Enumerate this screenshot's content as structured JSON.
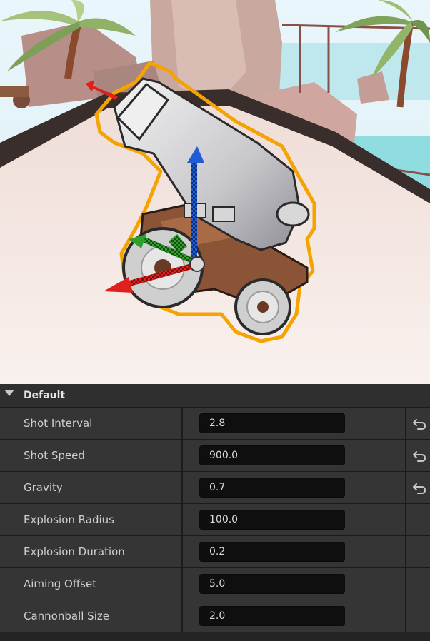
{
  "panel": {
    "category": "Default",
    "rows": [
      {
        "label": "Shot Interval",
        "value": "2.8",
        "resettable": true
      },
      {
        "label": "Shot Speed",
        "value": "900.0",
        "resettable": true
      },
      {
        "label": "Gravity",
        "value": "0.7",
        "resettable": true
      },
      {
        "label": "Explosion Radius",
        "value": "100.0",
        "resettable": false
      },
      {
        "label": "Explosion Duration",
        "value": "0.2",
        "resettable": false
      },
      {
        "label": "Aiming Offset",
        "value": "5.0",
        "resettable": false
      },
      {
        "label": "Cannonball Size",
        "value": "2.0",
        "resettable": false
      }
    ]
  },
  "icons": {
    "collapse": "triangle-down-icon",
    "reset": "reset-to-default-icon"
  },
  "colors": {
    "selection_outline": "#f5a300",
    "gizmo_x": "#e0201c",
    "gizmo_y": "#2fa12a",
    "gizmo_z": "#1f5cd6"
  }
}
